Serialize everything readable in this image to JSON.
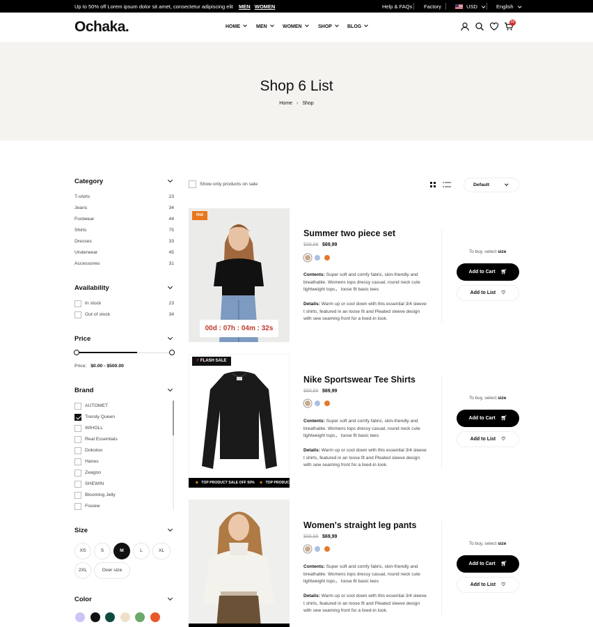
{
  "topbar": {
    "promo": "Up to 50% off Lorem ipsum dolor sit amet, consectetur adipiscing elit",
    "link_men": "MEN",
    "link_women": "WOMEN",
    "help": "Help & FAQs",
    "factory": "Factory",
    "currency": "USD",
    "language": "English"
  },
  "header": {
    "logo": "Ochaka.",
    "nav": [
      "HOME",
      "MEN",
      "WOMEN",
      "SHOP",
      "BLOG"
    ],
    "cart_count": "99"
  },
  "hero": {
    "title": "Shop 6 List",
    "breadcrumb_home": "Home",
    "breadcrumb_current": "Shop"
  },
  "sidebar": {
    "category_title": "Category",
    "categories": [
      {
        "label": "T-shirts",
        "count": "23"
      },
      {
        "label": "Jeans",
        "count": "34"
      },
      {
        "label": "Footwear",
        "count": "44"
      },
      {
        "label": "Shirts",
        "count": "75"
      },
      {
        "label": "Dresses",
        "count": "33"
      },
      {
        "label": "Underwear",
        "count": "45"
      },
      {
        "label": "Accessories",
        "count": "31"
      }
    ],
    "availability_title": "Availability",
    "availability": [
      {
        "label": "In stock",
        "count": "23"
      },
      {
        "label": "Out of stock",
        "count": "34"
      }
    ],
    "price_title": "Price",
    "price_label": "Price:",
    "price_range": "$0.00 - $500.00",
    "brand_title": "Brand",
    "brands": [
      {
        "label": "AUTOMET",
        "checked": false
      },
      {
        "label": "Trendy Queen",
        "checked": true
      },
      {
        "label": "WIHOLL",
        "checked": false
      },
      {
        "label": "Real Essentials",
        "checked": false
      },
      {
        "label": "Dokotoo",
        "checked": false
      },
      {
        "label": "Hanes",
        "checked": false
      },
      {
        "label": "Zeagoo",
        "checked": false
      },
      {
        "label": "SHEWIN",
        "checked": false
      },
      {
        "label": "Blooming Jelly",
        "checked": false
      },
      {
        "label": "Fisoew",
        "checked": false
      }
    ],
    "size_title": "Size",
    "sizes": [
      "XS",
      "S",
      "M",
      "L",
      "XL",
      "2XL",
      "Over size"
    ],
    "selected_size": "M",
    "color_title": "Color",
    "colors": [
      "#c9c6f7",
      "#111111",
      "#0f4a3e",
      "#eee0c8",
      "#6aa96a",
      "#e8582a"
    ]
  },
  "toolbar": {
    "sale_only": "Show only products on sale",
    "sort": "Default"
  },
  "products": [
    {
      "name": "Summer two piece set",
      "old_price": "$99,99",
      "price": "$69,99",
      "badge": "Hot",
      "timer": "00d : 07h : 04m : 32s",
      "colors": [
        "#c9a98a",
        "#a9c1dd",
        "#e27a2e"
      ],
      "contents_label": "Contents:",
      "contents": "Super soft and comfy fabric, skin-friendly and breathable. Womens tops dressy casual, round neck cute lightweight tops， loose fit basic tees",
      "details_label": "Details:",
      "details": "Warm up or cool down with this essential 3/4 sleeve t shirts, featured in an loose fit and Pleated sleeve design with sew seaming front for a lived-in look.",
      "to_buy": "To buy, select",
      "to_buy_bold": "size",
      "add_cart": "Add to Cart",
      "add_list": "Add to List"
    },
    {
      "name": "Nike Sportswear Tee Shirts",
      "old_price": "$99,99",
      "price": "$69,99",
      "badge": "FLASH SALE",
      "marquee": "TOP PRODUCT SALE OFF 50%",
      "colors": [
        "#c9a98a",
        "#a9c1dd",
        "#e27a2e"
      ],
      "contents_label": "Contents:",
      "contents": "Super soft and comfy fabric, skin-friendly and breathable. Womens tops dressy casual, round neck cute lightweight tops， loose fit basic tees",
      "details_label": "Details:",
      "details": "Warm up or cool down with this essential 3/4 sleeve t shirts, featured in an loose fit and Pleated sleeve design with sew seaming front for a lived-in look.",
      "to_buy": "To buy, select",
      "to_buy_bold": "size",
      "add_cart": "Add to Cart",
      "add_list": "Add to List"
    },
    {
      "name": "Women's straight leg pants",
      "old_price": "$99,99",
      "price": "$69,99",
      "colors": [
        "#c9a98a",
        "#a9c1dd",
        "#e27a2e"
      ],
      "contents_label": "Contents:",
      "contents": "Super soft and comfy fabric, skin-friendly and breathable. Womens tops dressy casual, round neck cute lightweight tops， loose fit basic tees",
      "details_label": "Details:",
      "details": "Warm up or cool down with this essential 3/4 sleeve t shirts, featured in an loose fit and Pleated sleeve design with sew seaming front for a lived-in look.",
      "to_buy": "To buy, select",
      "to_buy_bold": "size",
      "add_cart": "Add to Cart",
      "add_list": "Add to List"
    }
  ]
}
